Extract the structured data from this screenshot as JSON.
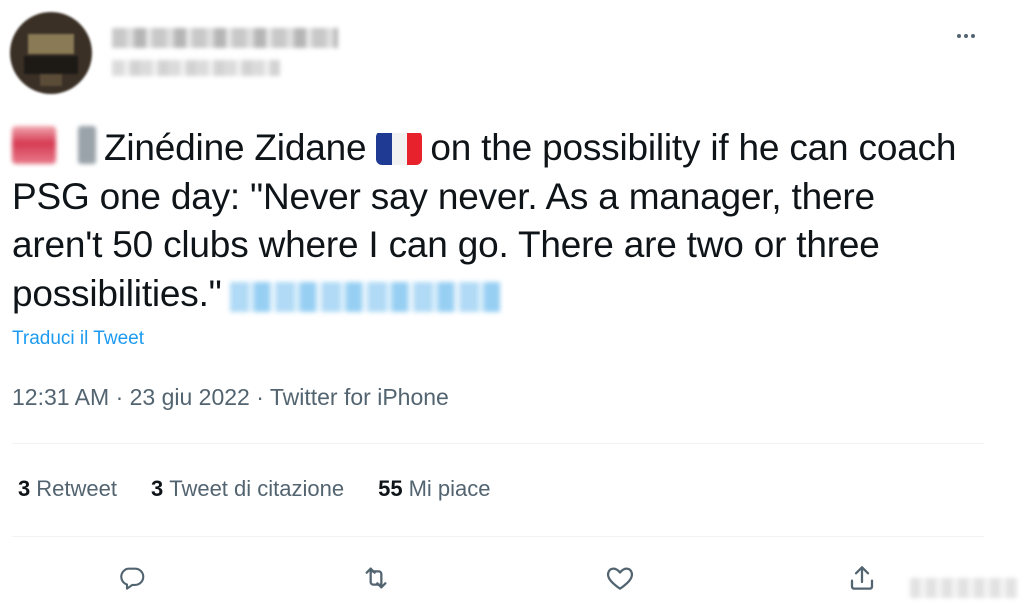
{
  "tweet": {
    "text_part1": "Zinédine Zidane",
    "text_part2": "on the possibility if he can coach PSG one day: \"Never say never. As a manager, there aren't 50 clubs where I can go. There are two or three possibilities.\"",
    "translate_label": "Traduci il Tweet",
    "meta": "12:31 AM · 23 giu 2022 · Twitter for iPhone"
  },
  "stats": [
    {
      "count": "3",
      "label": "Retweet"
    },
    {
      "count": "3",
      "label": "Tweet di citazione"
    },
    {
      "count": "55",
      "label": "Mi piace"
    }
  ],
  "icons": {
    "more": "more-horizontal-icon",
    "reply": "reply-icon",
    "retweet": "retweet-icon",
    "like": "heart-icon",
    "share": "share-icon",
    "flag": "france-flag-icon"
  },
  "colors": {
    "text": "#0f1419",
    "secondary": "#536471",
    "accent": "#1d9bf0",
    "divider": "#eff3f4"
  }
}
